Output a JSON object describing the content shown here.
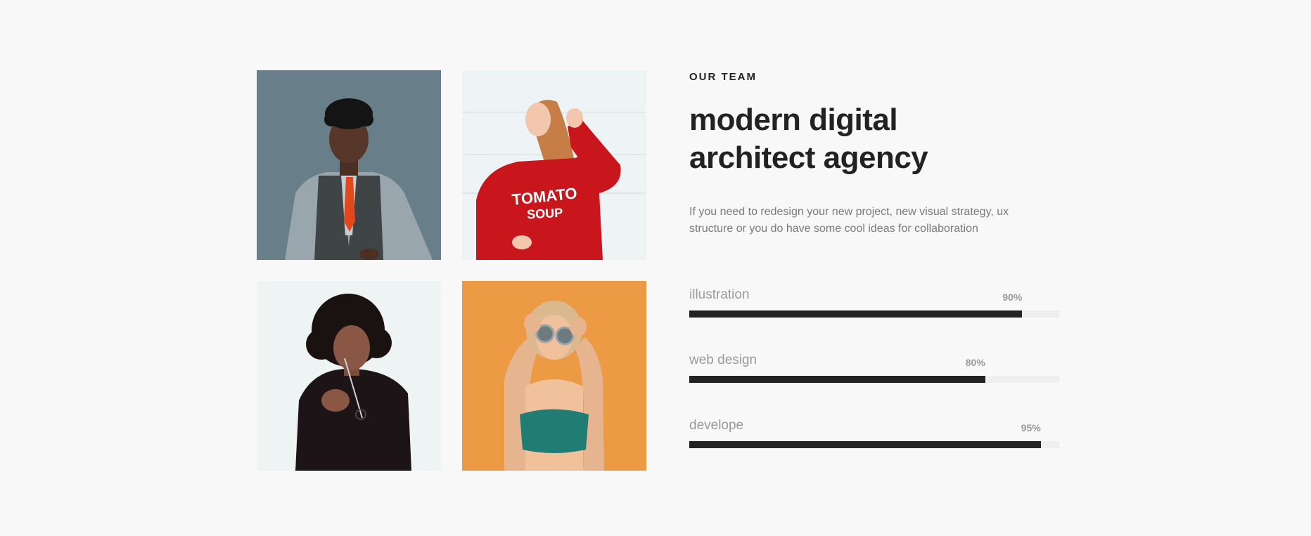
{
  "section": {
    "eyebrow": "OUR TEAM",
    "title": "modern digital\narchitect agency",
    "description": "If you need to redesign your new project, new visual strategy, ux structure or you do have some cool ideas for collaboration"
  },
  "skills": [
    {
      "label": "illustration",
      "percent_text": "90%",
      "value": 0.9
    },
    {
      "label": "web design",
      "percent_text": "80%",
      "value": 0.8
    },
    {
      "label": "develope",
      "percent_text": "95%",
      "value": 0.95
    }
  ],
  "photos": [
    {
      "name": "team-photo-man-suit"
    },
    {
      "name": "team-photo-woman-red-sweater",
      "shirt_text_1": "TOMATO",
      "shirt_text_2": "SOUP"
    },
    {
      "name": "team-photo-woman-black-top"
    },
    {
      "name": "team-photo-woman-orange-wall"
    }
  ],
  "colors": {
    "background": "#f8f8f8",
    "text_dark": "#222222",
    "text_muted": "#7a7a7a",
    "bar_fill": "#222222",
    "bar_track": "#eeeeee"
  }
}
